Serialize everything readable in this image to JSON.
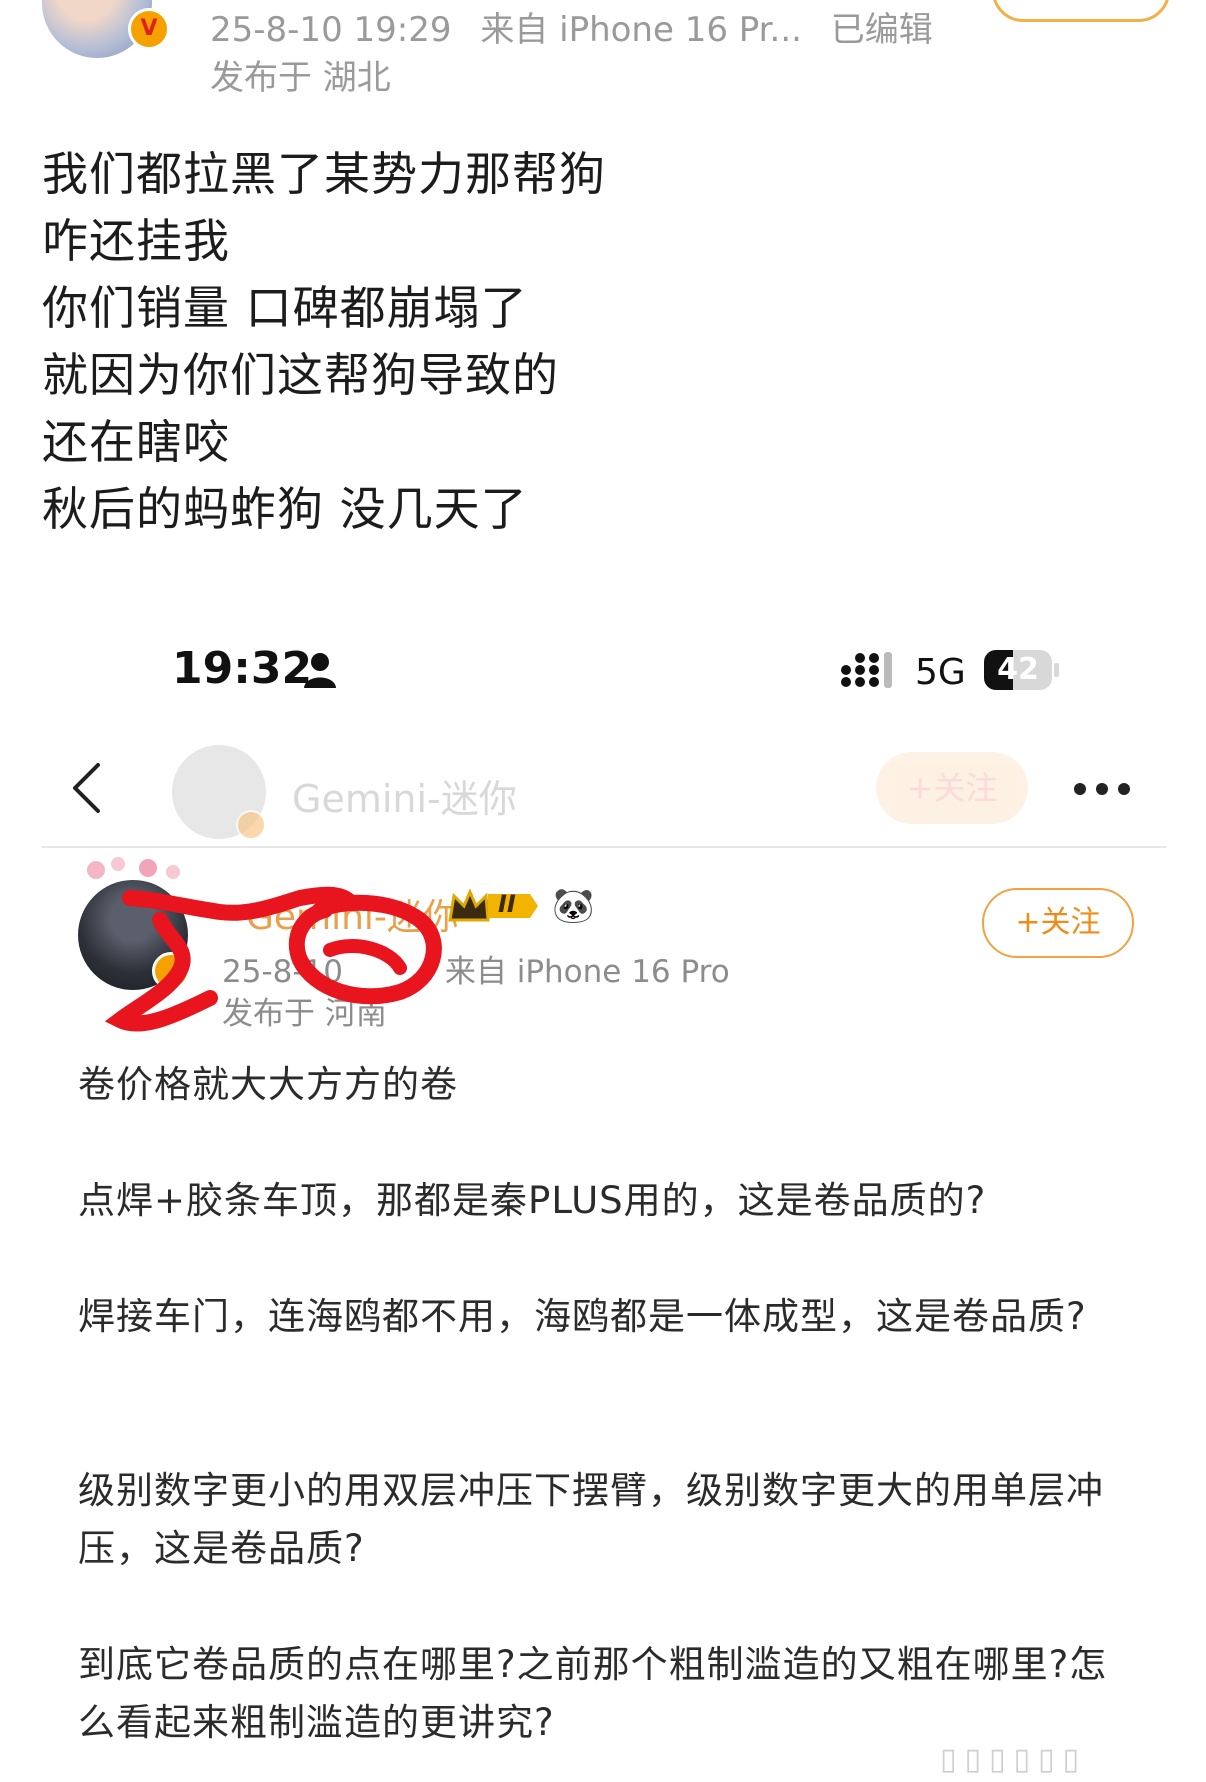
{
  "outer_post": {
    "meta_time": "25-8-10 19:29",
    "meta_source": "来自 iPhone 16 Pr...",
    "meta_edited": "已编辑",
    "meta_location": "发布于 湖北",
    "lines": [
      "我们都拉黑了某势力那帮狗",
      "咋还挂我",
      "你们销量 口碑都崩塌了",
      "就因为你们这帮狗导致的",
      "还在瞎咬",
      "秋后的蚂蚱狗  没几天了"
    ]
  },
  "screenshot": {
    "status_bar": {
      "time": "19:32",
      "network": "5G",
      "battery": "42"
    },
    "nav": {
      "name": "Gemini-迷你",
      "follow_label": "+关注"
    },
    "post": {
      "author": "Gemini-迷你",
      "level_badge": "II",
      "meta_time": "25-8-10",
      "meta_source": "来自 iPhone 16 Pro",
      "meta_location": "发布于 河南",
      "follow_label": "+关注",
      "paragraphs": [
        "卷价格就大大方方的卷",
        "点焊+胶条车顶，那都是秦PLUS用的，这是卷品质的?",
        "焊接车门，连海鸥都不用，海鸥都是一体成型，这是卷品质?",
        "级别数字更小的用双层冲压下摆臂，级别数字更大的用单层冲压，这是卷品质?",
        "到底它卷品质的点在哪里?之前那个粗制滥造的又粗在哪里?怎么看起来粗制滥造的更讲究?"
      ]
    }
  },
  "colors": {
    "accent": "#f08b16",
    "annotation": "#e8141e",
    "meta": "#9a9a9a"
  }
}
